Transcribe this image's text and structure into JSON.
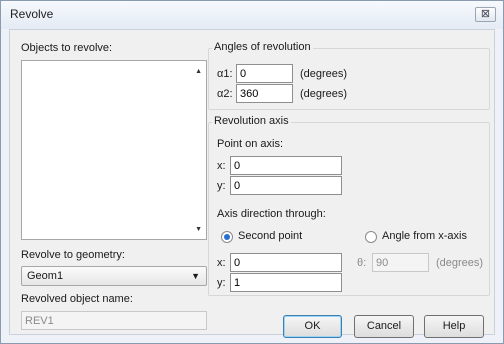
{
  "window": {
    "title": "Revolve",
    "close_glyph": "⊠"
  },
  "objects": {
    "label": "Objects to revolve:",
    "scroll_up": "▲",
    "scroll_down": "▼"
  },
  "revolve_to": {
    "label": "Revolve to geometry:",
    "value": "Geom1",
    "arrow": "▼"
  },
  "revolved_name": {
    "label": "Revolved object name:",
    "value": "REV1"
  },
  "angles": {
    "title": "Angles of revolution",
    "a1_label": "α1:",
    "a1_value": "0",
    "a2_label": "α2:",
    "a2_value": "360",
    "unit": "(degrees)"
  },
  "axis": {
    "title": "Revolution axis",
    "point_label": "Point on axis:",
    "px_label": "x:",
    "px_value": "0",
    "py_label": "y:",
    "py_value": "0",
    "direction_label": "Axis direction through:",
    "opt_second": "Second point",
    "opt_angle": "Angle from x-axis",
    "sx_label": "x:",
    "sx_value": "0",
    "sy_label": "y:",
    "sy_value": "1",
    "theta_label": "θ:",
    "theta_value": "90",
    "theta_unit": "(degrees)",
    "selected": "second-point"
  },
  "buttons": {
    "ok": "OK",
    "cancel": "Cancel",
    "help": "Help"
  }
}
